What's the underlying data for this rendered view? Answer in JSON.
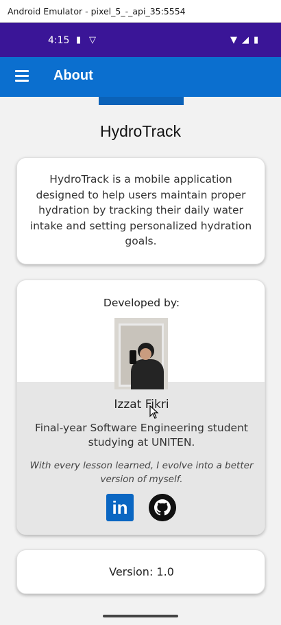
{
  "emulator": {
    "title": "Android Emulator - pixel_5_-_api_35:5554"
  },
  "status_bar": {
    "time": "4:15",
    "bg_color": "#3a1597"
  },
  "app_bar": {
    "title": "About",
    "bg_color": "#0b6fcf"
  },
  "app": {
    "name": "HydroTrack"
  },
  "description": {
    "text": "HydroTrack is a mobile application designed to help users maintain proper hydration by tracking their daily water intake and setting personalized hydration goals."
  },
  "developer": {
    "heading": "Developed by:",
    "name": "Izzat Fikri",
    "role": "Final-year Software Engineering student studying at UNITEN.",
    "quote": "With every lesson learned, I evolve into a better version of myself.",
    "links": [
      {
        "icon": "linkedin-icon",
        "label": "in"
      },
      {
        "icon": "github-icon"
      }
    ]
  },
  "version": {
    "text": "Version: 1.0"
  }
}
